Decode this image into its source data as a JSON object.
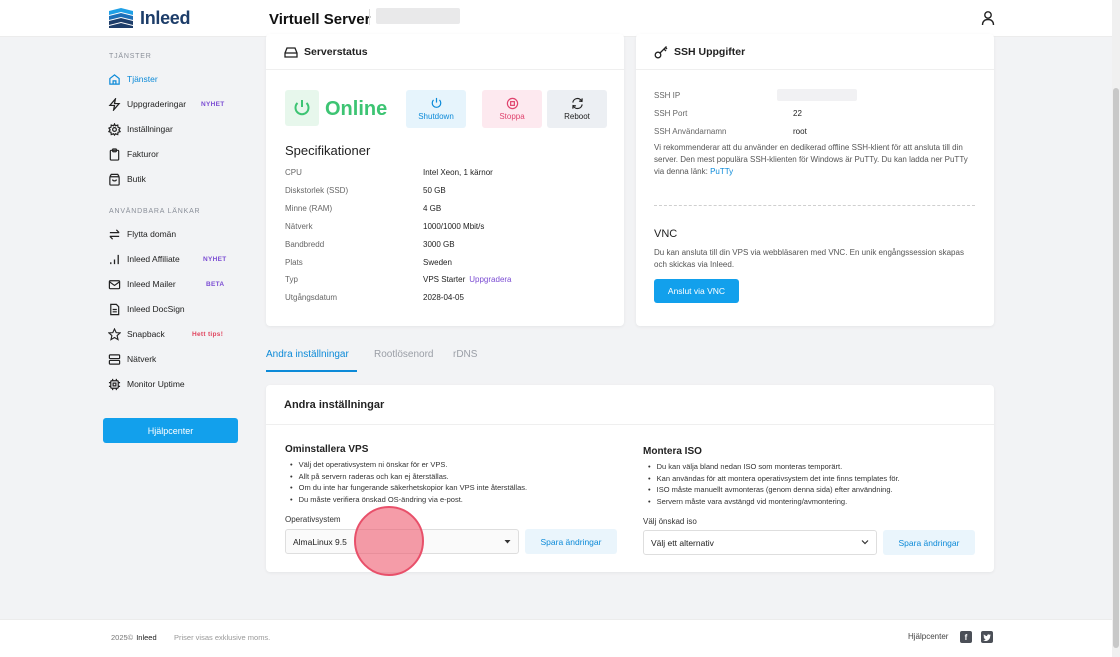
{
  "brand": {
    "name": "Inleed"
  },
  "header": {
    "title": "Virtuell Server"
  },
  "sidebar": {
    "services_heading": "TJÄNSTER",
    "services": [
      {
        "label": "Tjänster",
        "icon": "home-icon"
      },
      {
        "label": "Uppgraderingar",
        "icon": "bolt-icon",
        "badge": "NYHET"
      },
      {
        "label": "Inställningar",
        "icon": "gear-icon"
      },
      {
        "label": "Fakturor",
        "icon": "clipboard-icon"
      },
      {
        "label": "Butik",
        "icon": "shop-icon"
      }
    ],
    "links_heading": "ANVÄNDBARA LÄNKAR",
    "links": [
      {
        "label": "Flytta domän",
        "icon": "transfer-icon"
      },
      {
        "label": "Inleed Affiliate",
        "icon": "bar-chart-icon",
        "badge": "NYHET"
      },
      {
        "label": "Inleed Mailer",
        "icon": "mail-icon",
        "badge": "BETA"
      },
      {
        "label": "Inleed DocSign",
        "icon": "document-icon"
      },
      {
        "label": "Snapback",
        "icon": "star-icon",
        "badge": "Hett tips!"
      },
      {
        "label": "Nätverk",
        "icon": "server-icon"
      },
      {
        "label": "Monitor Uptime",
        "icon": "chip-icon"
      }
    ],
    "help_button": "Hjälpcenter"
  },
  "server_status": {
    "title": "Serverstatus",
    "status": "Online",
    "actions": {
      "shutdown": "Shutdown",
      "stop": "Stoppa",
      "reboot": "Reboot"
    },
    "spec_title": "Specifikationer",
    "specs": [
      {
        "key": "CPU",
        "value": "Intel Xeon, 1 kärnor"
      },
      {
        "key": "Diskstorlek (SSD)",
        "value": "50 GB"
      },
      {
        "key": "Minne (RAM)",
        "value": "4 GB"
      },
      {
        "key": "Nätverk",
        "value": "1000/1000 Mbit/s"
      },
      {
        "key": "Bandbredd",
        "value": "3000 GB"
      },
      {
        "key": "Plats",
        "value": "Sweden"
      },
      {
        "key": "Typ",
        "value": "VPS Starter",
        "link": "Uppgradera"
      },
      {
        "key": "Utgångsdatum",
        "value": "2028-04-05"
      }
    ]
  },
  "ssh": {
    "title": "SSH Uppgifter",
    "ip_label": "SSH IP",
    "port_label": "SSH Port",
    "port_value": "22",
    "user_label": "SSH Användarnamn",
    "user_value": "root",
    "note": "Vi rekommenderar att du använder en dedikerad offline SSH-klient för att ansluta till din server. Den mest populära SSH-klienten för Windows är PuTTy. Du kan ladda ner PuTTy via denna länk:",
    "note_link": "PuTTy"
  },
  "vnc": {
    "title": "VNC",
    "note": "Du kan ansluta till din VPS via webbläsaren med VNC. En unik engångssession skapas och skickas via Inleed.",
    "button": "Anslut via VNC"
  },
  "tabs": [
    "Andra inställningar",
    "Rootlösenord",
    "rDNS"
  ],
  "settings": {
    "title": "Andra inställningar",
    "reinstall": {
      "title": "Ominstallera VPS",
      "bullets": [
        "Välj det operativsystem ni önskar för er VPS.",
        "Allt på servern raderas och kan ej återställas.",
        "Om du inte har fungerande säkerhetskopior kan VPS inte återställas.",
        "Du måste verifiera önskad OS-ändring via e-post."
      ],
      "field_label": "Operativsystem",
      "select_value": "AlmaLinux 9.5",
      "save": "Spara ändringar"
    },
    "iso": {
      "title": "Montera ISO",
      "bullets": [
        "Du kan välja bland nedan ISO som monteras temporärt.",
        "Kan användas för att montera operativsystem det inte finns templates för.",
        "ISO måste manuellt avmonteras (genom denna sida) efter användning.",
        "Servern måste vara avstängd vid montering/avmontering."
      ],
      "field_label": "Välj önskad iso",
      "select_value": "Välj ett alternativ",
      "save": "Spara ändringar"
    }
  },
  "footer": {
    "copyright": "2025©",
    "brand": "Inleed",
    "note": "Priser visas exklusive moms.",
    "help": "Hjälpcenter"
  },
  "colors": {
    "accent": "#12a0ec",
    "online": "#3dc473",
    "badge_purple": "#7b4cd3",
    "badge_red": "#e0445e"
  }
}
